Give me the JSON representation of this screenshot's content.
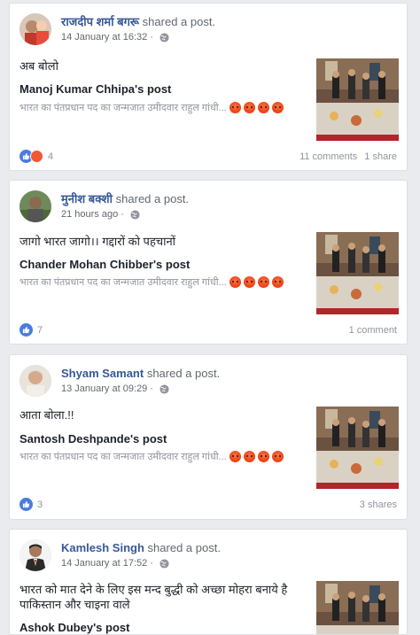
{
  "posts": [
    {
      "author": "राजदीप शर्मा बगरू",
      "action": "shared a post.",
      "time": "14 January at 16:32",
      "status": "अब बोलो",
      "shared_title": "Manoj Kumar Chhipa's post",
      "excerpt": "भारत का पंतप्रधान पद का जन्मजात उमीदवार राहुल गांधी...",
      "reactions": "4",
      "comments": "11 comments",
      "shares": "1 share"
    },
    {
      "author": "मुनीश बक्शी",
      "action": "shared a post.",
      "time": "21 hours ago",
      "status": "जागो भारत जागो।। गद्दारों को पहचानों",
      "shared_title": "Chander Mohan Chibber's post",
      "excerpt": "भारत का पंतप्रधान पद का जन्मजात उमीदवार राहुल गांधी...",
      "reactions": "7",
      "comments": "1 comment",
      "shares": ""
    },
    {
      "author": "Shyam Samant",
      "action": "shared a post.",
      "time": "13 January at 09:29",
      "status": "आता बोला.!!",
      "shared_title": "Santosh Deshpande's post",
      "excerpt": "भारत का पंतप्रधान पद का जन्मजात उमीदवार राहुल गांधी...",
      "reactions": "3",
      "comments": "",
      "shares": "3 shares"
    },
    {
      "author": "Kamlesh Singh",
      "action": "shared a post.",
      "time": "14 January at 17:52",
      "status": "भारत को मात देने के लिए इस मन्द बुद्धी को अच्छा मोहरा बनाये है पाकिस्तान और चाइना वाले",
      "shared_title": "Ashok Dubey's post",
      "excerpt": "",
      "reactions": "",
      "comments": "",
      "shares": ""
    }
  ],
  "colors": {
    "link": "#365899",
    "like": "#4a7bde",
    "angry": "#f15833",
    "bg": "#e9ebee"
  },
  "icons": [
    "globe-icon",
    "like-icon",
    "angry-icon",
    "angry-emoji-icon"
  ]
}
